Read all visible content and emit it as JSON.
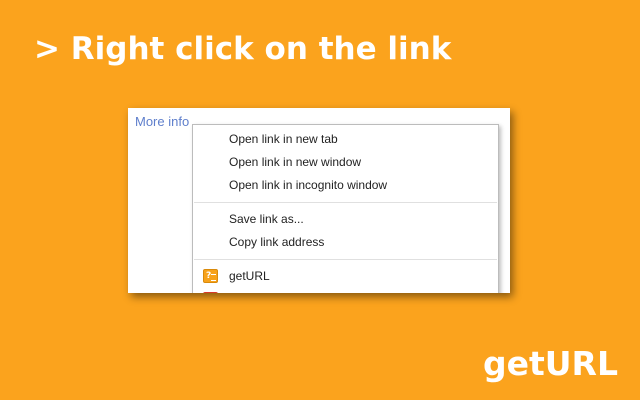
{
  "headline": "> Right click on the link",
  "brand": "getURL",
  "page": {
    "link_text": "More info"
  },
  "context_menu": {
    "items": [
      {
        "label": "Open link in new tab"
      },
      {
        "label": "Open link in new window"
      },
      {
        "label": "Open link in incognito window"
      },
      {
        "label": "Save link as..."
      },
      {
        "label": "Copy link address"
      },
      {
        "label": "getURL",
        "icon": "geturl-extension-icon"
      },
      {
        "label": "",
        "icon": "extension-icon-red"
      }
    ]
  },
  "colors": {
    "background": "#fba31d",
    "link": "#5f7fcc",
    "extension_icon": "#f7a21b",
    "extension_icon_red": "#d8392b"
  }
}
